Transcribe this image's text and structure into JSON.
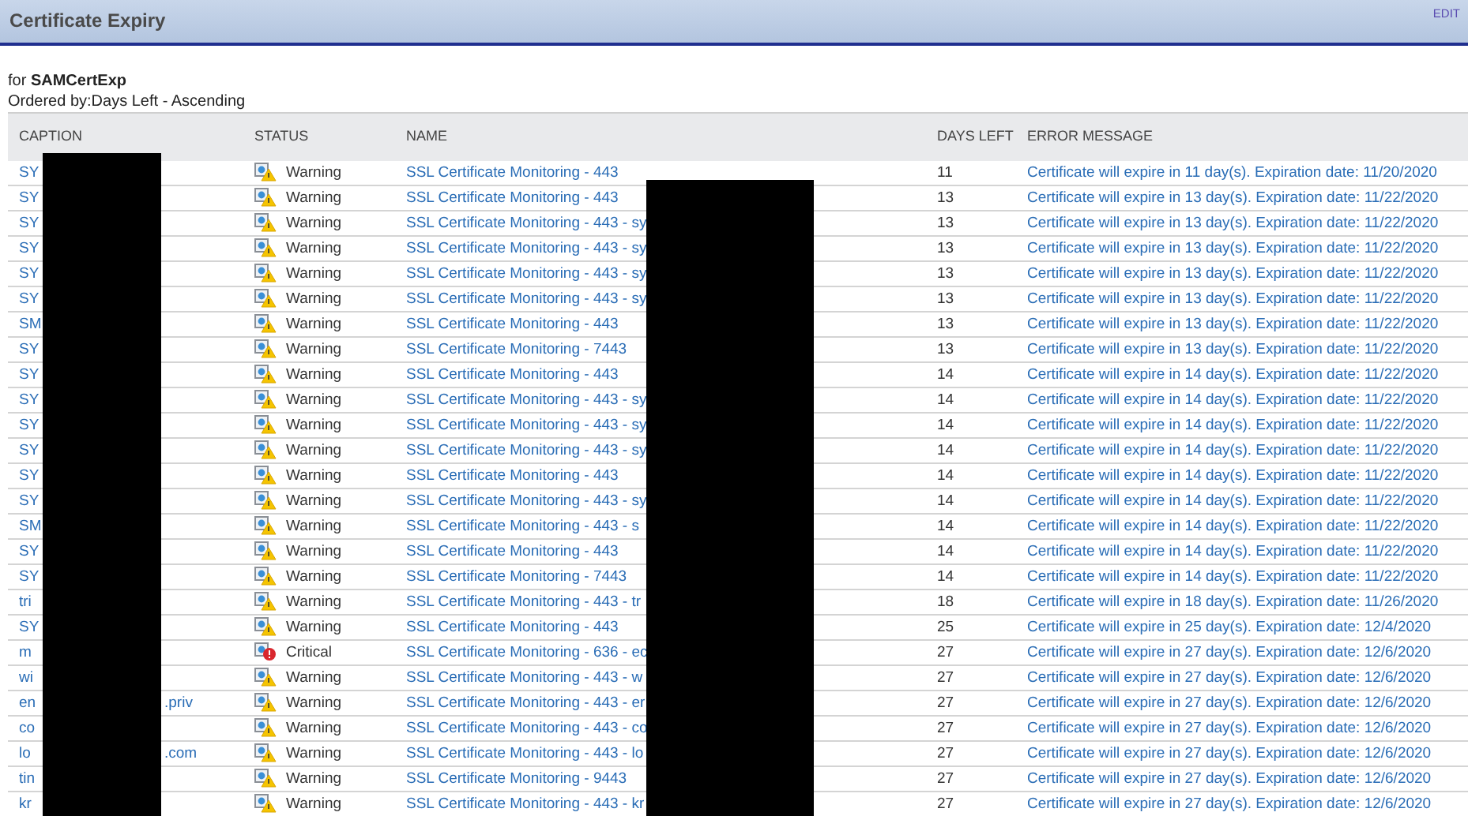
{
  "header": {
    "title": "Certificate Expiry",
    "edit": "EDIT"
  },
  "subtitle": "for **SAMCertExp**",
  "ordered": "Ordered by:Days Left - Ascending",
  "columns": [
    "CAPTION",
    "STATUS",
    "NAME",
    "DAYS LEFT",
    "ERROR MESSAGE"
  ],
  "rows": [
    {
      "caption": "SY",
      "kind": "warning",
      "status_label": "Warning",
      "name": "SSL Certificate Monitoring - 443",
      "days": "11",
      "message": "Certificate will expire in 11 day(s). Expiration date: 11/20/2020"
    },
    {
      "caption": "SY",
      "kind": "warning",
      "status_label": "Warning",
      "name": "SSL Certificate Monitoring - 443",
      "days": "13",
      "message": "Certificate will expire in 13 day(s). Expiration date: 11/22/2020"
    },
    {
      "caption": "SY",
      "kind": "warning",
      "status_label": "Warning",
      "name": "SSL Certificate Monitoring - 443 - sy",
      "days": "13",
      "message": "Certificate will expire in 13 day(s). Expiration date: 11/22/2020"
    },
    {
      "caption": "SY",
      "kind": "warning",
      "status_label": "Warning",
      "name": "SSL Certificate Monitoring - 443 - sy",
      "days": "13",
      "message": "Certificate will expire in 13 day(s). Expiration date: 11/22/2020"
    },
    {
      "caption": "SY",
      "kind": "warning",
      "status_label": "Warning",
      "name": "SSL Certificate Monitoring - 443 - sy",
      "days": "13",
      "message": "Certificate will expire in 13 day(s). Expiration date: 11/22/2020"
    },
    {
      "caption": "SY",
      "kind": "warning",
      "status_label": "Warning",
      "name": "SSL Certificate Monitoring - 443 - sy",
      "days": "13",
      "message": "Certificate will expire in 13 day(s). Expiration date: 11/22/2020"
    },
    {
      "caption": "SM",
      "kind": "warning",
      "status_label": "Warning",
      "name": "SSL Certificate Monitoring - 443",
      "days": "13",
      "message": "Certificate will expire in 13 day(s). Expiration date: 11/22/2020"
    },
    {
      "caption": "SY",
      "kind": "warning",
      "status_label": "Warning",
      "name": "SSL Certificate Monitoring - 7443",
      "days": "13",
      "message": "Certificate will expire in 13 day(s). Expiration date: 11/22/2020"
    },
    {
      "caption": "SY",
      "kind": "warning",
      "status_label": "Warning",
      "name": "SSL Certificate Monitoring - 443",
      "days": "14",
      "message": "Certificate will expire in 14 day(s). Expiration date: 11/22/2020"
    },
    {
      "caption": "SY",
      "kind": "warning",
      "status_label": "Warning",
      "name": "SSL Certificate Monitoring - 443 - sy",
      "days": "14",
      "message": "Certificate will expire in 14 day(s). Expiration date: 11/22/2020"
    },
    {
      "caption": "SY",
      "kind": "warning",
      "status_label": "Warning",
      "name": "SSL Certificate Monitoring - 443 - sy",
      "days": "14",
      "message": "Certificate will expire in 14 day(s). Expiration date: 11/22/2020"
    },
    {
      "caption": "SY",
      "kind": "warning",
      "status_label": "Warning",
      "name": "SSL Certificate Monitoring - 443 - sy",
      "days": "14",
      "message": "Certificate will expire in 14 day(s). Expiration date: 11/22/2020"
    },
    {
      "caption": "SY",
      "kind": "warning",
      "status_label": "Warning",
      "name": "SSL Certificate Monitoring - 443",
      "days": "14",
      "message": "Certificate will expire in 14 day(s). Expiration date: 11/22/2020"
    },
    {
      "caption": "SY",
      "kind": "warning",
      "status_label": "Warning",
      "name": "SSL Certificate Monitoring - 443 - sy",
      "days": "14",
      "message": "Certificate will expire in 14 day(s). Expiration date: 11/22/2020"
    },
    {
      "caption": "SM",
      "kind": "warning",
      "status_label": "Warning",
      "name": "SSL Certificate Monitoring - 443 - s",
      "days": "14",
      "message": "Certificate will expire in 14 day(s). Expiration date: 11/22/2020"
    },
    {
      "caption": "SY",
      "kind": "warning",
      "status_label": "Warning",
      "name": "SSL Certificate Monitoring - 443",
      "days": "14",
      "message": "Certificate will expire in 14 day(s). Expiration date: 11/22/2020"
    },
    {
      "caption": "SY",
      "kind": "warning",
      "status_label": "Warning",
      "name": "SSL Certificate Monitoring - 7443",
      "days": "14",
      "message": "Certificate will expire in 14 day(s). Expiration date: 11/22/2020"
    },
    {
      "caption": "tri",
      "kind": "warning",
      "status_label": "Warning",
      "name": "SSL Certificate Monitoring - 443 - tr",
      "days": "18",
      "message": "Certificate will expire in 18 day(s). Expiration date: 11/26/2020"
    },
    {
      "caption": "SY",
      "kind": "warning",
      "status_label": "Warning",
      "name": "SSL Certificate Monitoring - 443",
      "days": "25",
      "message": "Certificate will expire in 25 day(s). Expiration date: 12/4/2020"
    },
    {
      "caption": "m",
      "kind": "critical",
      "status_label": "Critical",
      "name": "SSL Certificate Monitoring - 636 - ec",
      "days": "27",
      "message": "Certificate will expire in 27 day(s). Expiration date: 12/6/2020"
    },
    {
      "caption": "wi",
      "kind": "warning",
      "status_label": "Warning",
      "name": "SSL Certificate Monitoring - 443 - w",
      "days": "27",
      "message": "Certificate will expire in 27 day(s). Expiration date: 12/6/2020"
    },
    {
      "caption": "en",
      "caption_tail": ".priv",
      "kind": "warning",
      "status_label": "Warning",
      "name": "SSL Certificate Monitoring - 443 - er",
      "days": "27",
      "message": "Certificate will expire in 27 day(s). Expiration date: 12/6/2020"
    },
    {
      "caption": "co",
      "kind": "warning",
      "status_label": "Warning",
      "name": "SSL Certificate Monitoring - 443 - co",
      "days": "27",
      "message": "Certificate will expire in 27 day(s). Expiration date: 12/6/2020"
    },
    {
      "caption": "lo",
      "caption_tail": ".com",
      "kind": "warning",
      "status_label": "Warning",
      "name": "SSL Certificate Monitoring - 443 - lo",
      "days": "27",
      "message": "Certificate will expire in 27 day(s). Expiration date: 12/6/2020"
    },
    {
      "caption": "tin",
      "kind": "warning",
      "status_label": "Warning",
      "name": "SSL Certificate Monitoring - 9443",
      "days": "27",
      "message": "Certificate will expire in 27 day(s). Expiration date: 12/6/2020"
    },
    {
      "caption": "kr",
      "kind": "warning",
      "status_label": "Warning",
      "name": "SSL Certificate Monitoring - 443 - kr",
      "days": "27",
      "message": "Certificate will expire in 27 day(s). Expiration date: 12/6/2020"
    }
  ]
}
